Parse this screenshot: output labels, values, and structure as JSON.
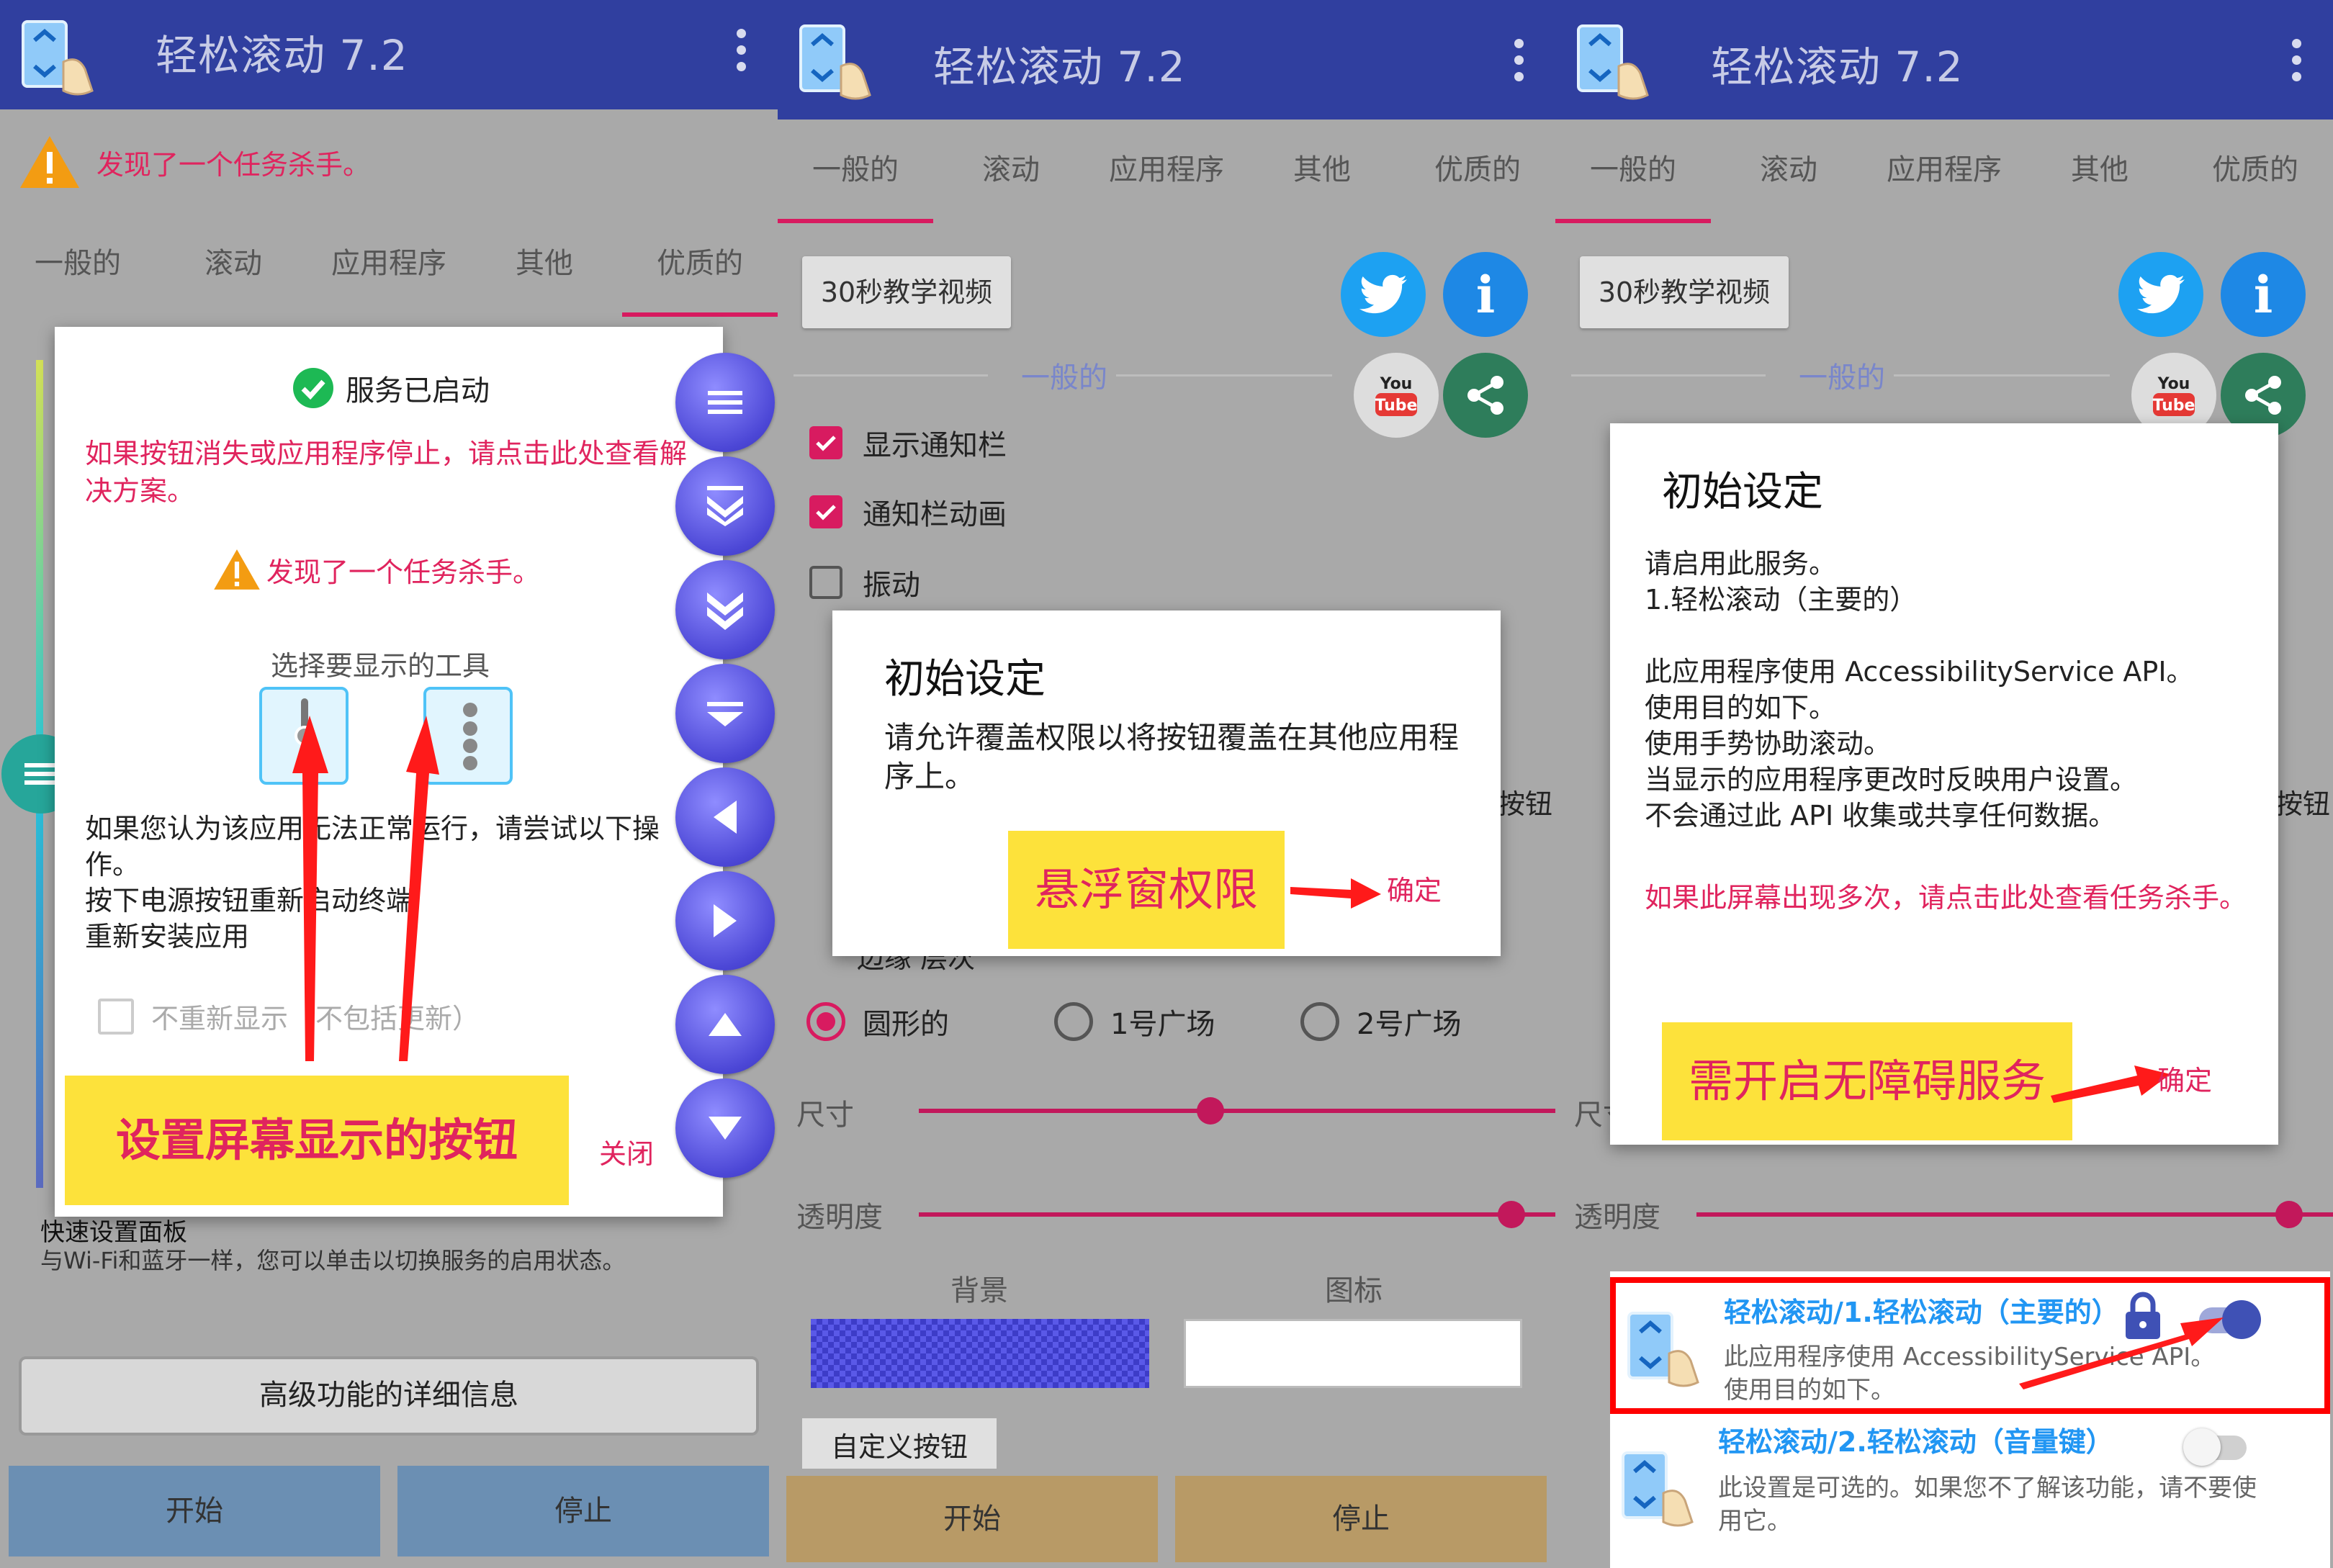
{
  "app": {
    "title": "轻松滚动 7.2"
  },
  "tabs": [
    "一般的",
    "滚动",
    "应用程序",
    "其他",
    "优质的"
  ],
  "panel1": {
    "warning_banner": "发现了一个任务杀手。",
    "service_started": "服务已启动",
    "help_link": "如果按钮消失或应用程序停止，请点击此处查看解决方案。",
    "task_killer_warning": "发现了一个任务杀手。",
    "choose_tools_label": "选择要显示的工具",
    "troubleshoot_text": [
      "如果您认为该应用无法正常运行，请尝试以下操作。",
      "按下电源按钮重新启动终端",
      "重新安装应用"
    ],
    "dont_show_again": "不重新显示（不包括更新）",
    "annotation": "设置屏幕显示的按钮",
    "close_label": "关闭",
    "quick_settings_title": "快速设置面板",
    "quick_settings_desc": "与Wi-Fi和蓝牙一样，您可以单击以切换服务的启用状态。",
    "advanced_button": "高级功能的详细信息",
    "start_button": "开始",
    "stop_button": "停止"
  },
  "panel2": {
    "tutorial_button": "30秒教学视频",
    "section_general": "一般的",
    "checkboxes": [
      {
        "label": "显示通知栏",
        "checked": true
      },
      {
        "label": "通知栏动画",
        "checked": true
      },
      {
        "label": "振动",
        "checked": false
      }
    ],
    "dialog_title": "初始设定",
    "dialog_body": "请允许覆盖权限以将按钮覆盖在其他应用程序上。",
    "annotation": "悬浮窗权限",
    "ok_label": "确定",
    "partial_button_text": "按钮",
    "partial_row_text": "边缘   层次",
    "radios": [
      {
        "label": "圆形的",
        "selected": true
      },
      {
        "label": "1号广场",
        "selected": false
      },
      {
        "label": "2号广场",
        "selected": false
      }
    ],
    "size_label": "尺寸",
    "size_value": 0.5,
    "opacity_label": "透明度",
    "opacity_value": 1.0,
    "background_label": "背景",
    "icon_label": "图标",
    "custom_button_label": "自定义按钮",
    "start_button": "开始",
    "stop_button": "停止"
  },
  "panel3": {
    "tutorial_button": "30秒教学视频",
    "section_general": "一般的",
    "dialog_title": "初始设定",
    "dialog_lines": [
      "请启用此服务。",
      "1.轻松滚动（主要的）",
      "",
      "此应用程序使用 AccessibilityService API。",
      "使用目的如下。",
      "使用手势协助滚动。",
      "当显示的应用程序更改时反映用户设置。",
      "不会通过此 API 收集或共享任何数据。"
    ],
    "dialog_link": "如果此屏幕出现多次，请点击此处查看任务杀手。",
    "annotation": "需开启无障碍服务",
    "ok_label": "确定",
    "partial_button_text": "按钮",
    "size_label": "尺寸",
    "opacity_label": "透明度",
    "opacity_value": 1.0,
    "services": [
      {
        "title": "轻松滚动/1.轻松滚动（主要的）",
        "desc": "此应用程序使用 AccessibilityService API。使用目的如下。",
        "enabled": true
      },
      {
        "title": "轻松滚动/2.轻松滚动（音量键）",
        "desc": "此设置是可选的。如果您不了解该功能，请不要使用它。",
        "enabled": false
      }
    ],
    "start_button": "开始",
    "stop_button": "停止"
  },
  "colors": {
    "appbar": "#303f9f",
    "accent_pink": "#d81b60",
    "warning_red": "#e0245e",
    "highlight_yellow": "#fde23b",
    "fab_purple": "#5a55e0"
  },
  "icons": [
    "app-icon",
    "warning-icon",
    "check-circle-icon",
    "twitter-icon",
    "info-icon",
    "youtube-icon",
    "share-icon",
    "lock-icon",
    "menu-icon"
  ]
}
